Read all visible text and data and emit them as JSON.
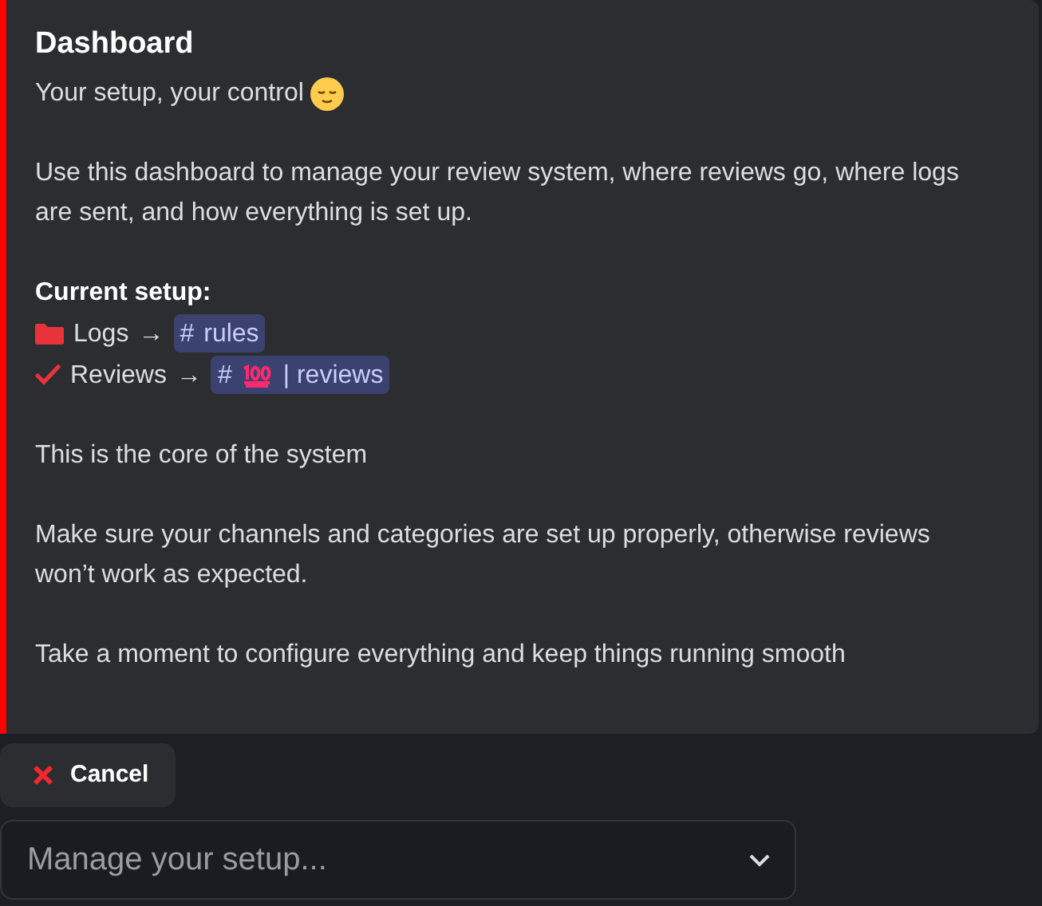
{
  "embed": {
    "title": "Dashboard",
    "tagline": "Your setup, your control",
    "intro": "Use this dashboard to manage your review system, where reviews go, where logs are sent, and how everything is set up.",
    "setup_heading": "Current setup:",
    "setup_items": [
      {
        "kind": "folder",
        "label": "Logs",
        "arrow": "→",
        "channel": {
          "hash": "#",
          "kind": "plain",
          "name": "rules"
        }
      },
      {
        "kind": "check",
        "label": "Reviews",
        "arrow": "→",
        "channel": {
          "hash": "#",
          "kind": "hundred",
          "name": "| reviews"
        }
      }
    ],
    "paragraphs": [
      "This is the core of the system",
      "Make sure your channels and categories are set up properly, otherwise reviews won’t work as expected.",
      "Take a moment to configure everything and keep things running smooth"
    ]
  },
  "cancel_button": {
    "label": "Cancel"
  },
  "select": {
    "placeholder": "Manage your setup..."
  }
}
